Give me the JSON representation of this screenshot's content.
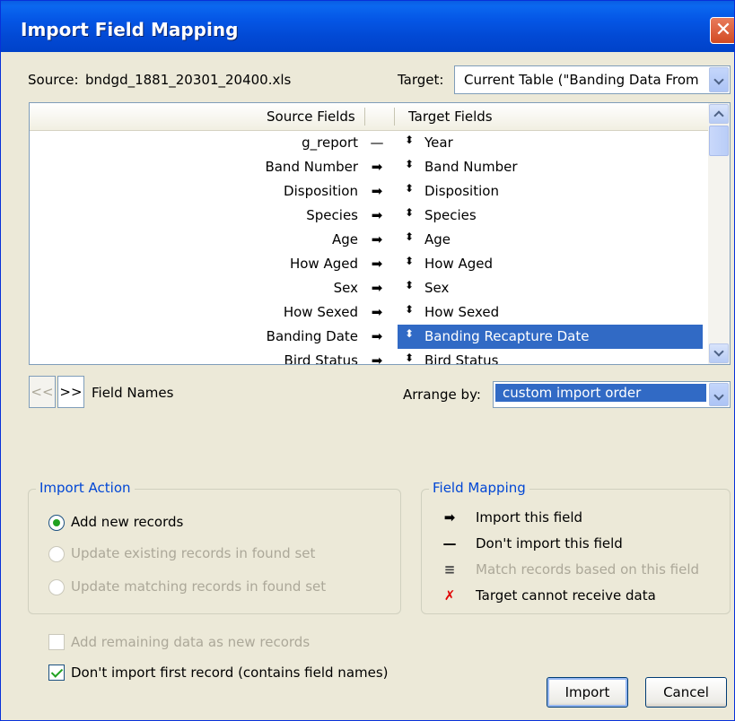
{
  "window": {
    "title": "Import Field Mapping",
    "close_glyph": "✕"
  },
  "source": {
    "label": "Source:",
    "filename": "bndgd_1881_20301_20400.xls"
  },
  "target": {
    "label": "Target:",
    "value": "Current Table (\"Banding Data From"
  },
  "table": {
    "headers": {
      "source": "Source Fields",
      "target": "Target Fields"
    },
    "rows": [
      {
        "source": "g_report",
        "arrow": "—",
        "target": "Year"
      },
      {
        "source": "Band Number",
        "arrow": "➡",
        "target": "Band Number"
      },
      {
        "source": "Disposition",
        "arrow": "➡",
        "target": "Disposition"
      },
      {
        "source": "Species",
        "arrow": "➡",
        "target": "Species"
      },
      {
        "source": "Age",
        "arrow": "➡",
        "target": "Age"
      },
      {
        "source": "How Aged",
        "arrow": "➡",
        "target": "How Aged"
      },
      {
        "source": "Sex",
        "arrow": "➡",
        "target": "Sex"
      },
      {
        "source": "How Sexed",
        "arrow": "➡",
        "target": "How Sexed"
      },
      {
        "source": "Banding Date",
        "arrow": "➡",
        "target": "Banding Recapture Date"
      },
      {
        "source": "Bird Status",
        "arrow": "➡",
        "target": "Bird Status"
      }
    ],
    "selected_row": 8,
    "handle_glyph": "⬍"
  },
  "nav": {
    "prev": "<<",
    "next": ">>",
    "label": "Field Names"
  },
  "arrange": {
    "label": "Arrange by:",
    "value": "custom import order"
  },
  "import_action": {
    "legend": "Import Action",
    "options": [
      {
        "label": "Add new records",
        "selected": true,
        "enabled": true
      },
      {
        "label": "Update existing records in found set",
        "selected": false,
        "enabled": false
      },
      {
        "label": "Update matching records in found set",
        "selected": false,
        "enabled": false
      }
    ]
  },
  "field_mapping": {
    "legend": "Field Mapping",
    "items": [
      {
        "glyph": "➡",
        "label": "Import this field",
        "enabled": true,
        "color": "#000000"
      },
      {
        "glyph": "—",
        "label": "Don't import this field",
        "enabled": true,
        "color": "#000000"
      },
      {
        "glyph": "≡",
        "label": "Match records based on this field",
        "enabled": false,
        "color": "#444444"
      },
      {
        "glyph": "✗",
        "label": "Target cannot receive data",
        "enabled": true,
        "color": "#e00000"
      }
    ]
  },
  "options": {
    "add_remaining": {
      "label": "Add remaining data as new records",
      "checked": false,
      "enabled": false
    },
    "dont_import_first": {
      "label": "Don't import first record (contains field names)",
      "checked": true,
      "enabled": true
    }
  },
  "buttons": {
    "import": "Import",
    "cancel": "Cancel"
  },
  "colors": {
    "title_bar": "#0049d4",
    "selection": "#316ac5",
    "group_legend": "#0046d5",
    "dialog_bg": "#ece9d8"
  }
}
